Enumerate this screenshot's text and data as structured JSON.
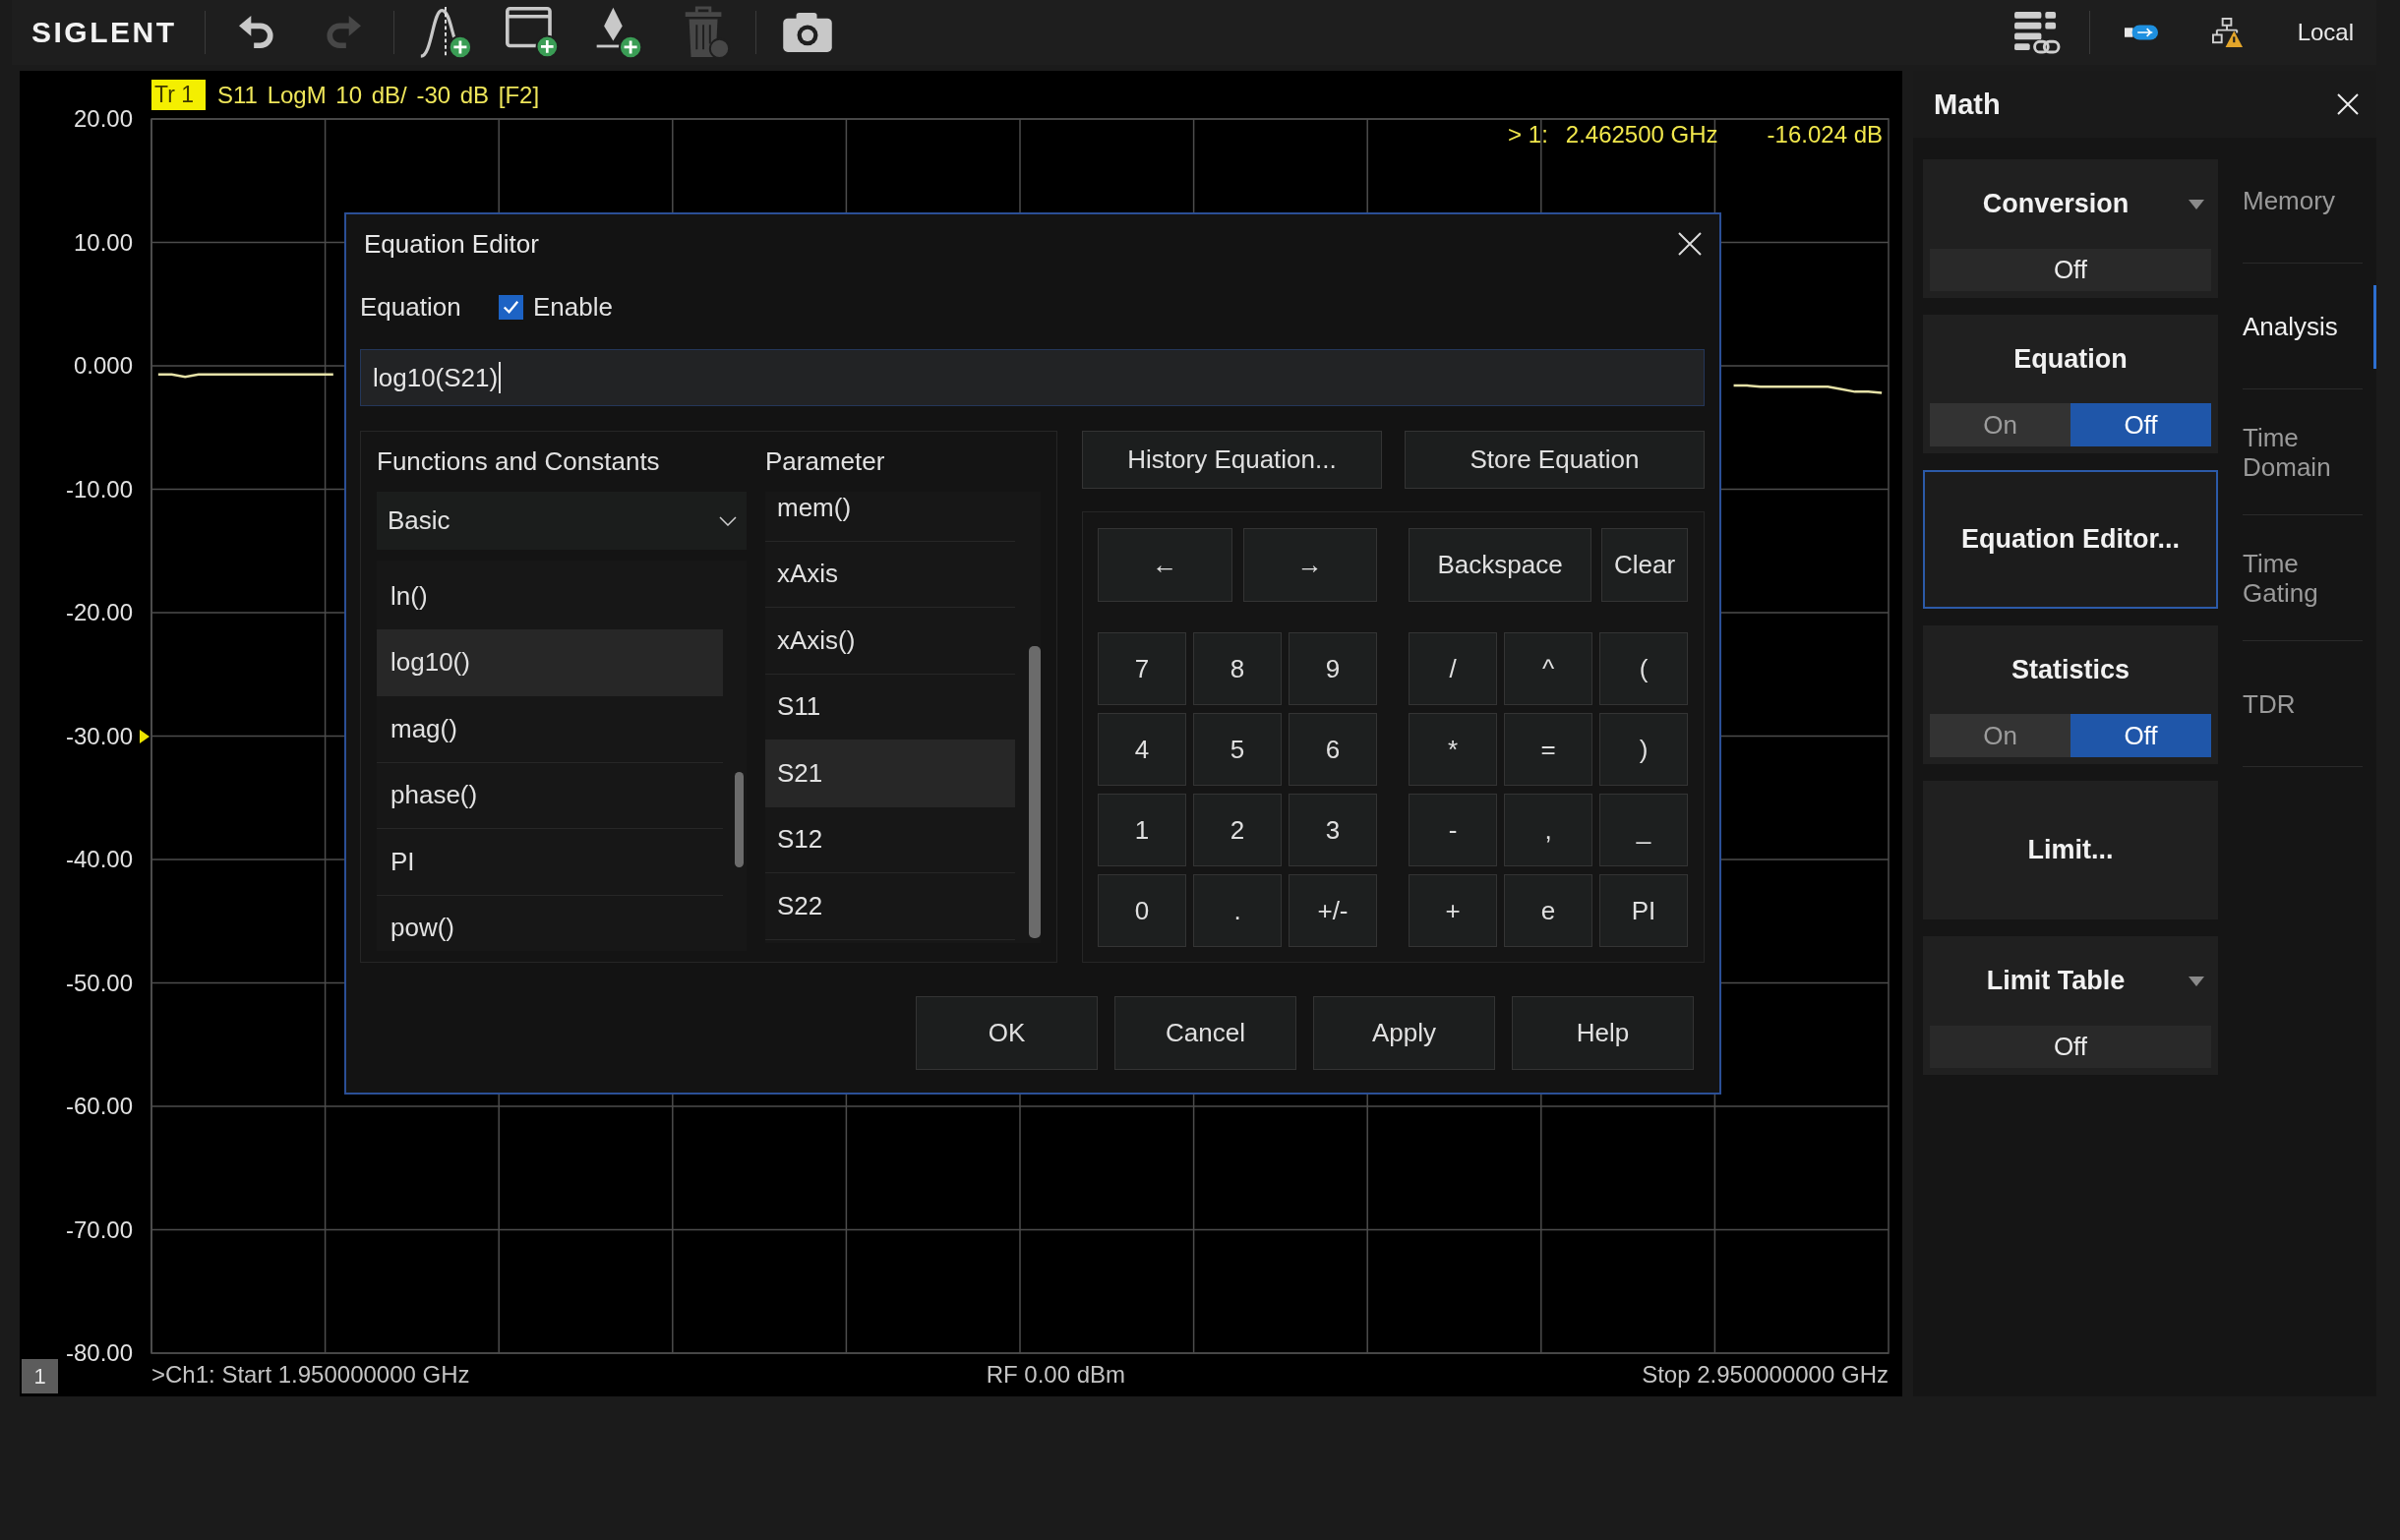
{
  "toolbar": {
    "logo": "SIGLENT",
    "tool_groups": [
      [
        {
          "kind": "undo",
          "disabled": false
        },
        {
          "kind": "redo",
          "disabled": true
        }
      ],
      [
        {
          "kind": "add-trace",
          "disabled": false
        },
        {
          "kind": "add-window",
          "disabled": false
        },
        {
          "kind": "add-marker",
          "disabled": false
        },
        {
          "kind": "delete",
          "disabled": true
        }
      ],
      [
        {
          "kind": "screenshot",
          "disabled": false
        }
      ]
    ],
    "remote_status": "Local"
  },
  "chart": {
    "trace_info": "S11 LogM 10 dB/ -30 dB [F2]",
    "marker": {
      "label": "> 1:",
      "frequency": "2.462500 GHz",
      "value": "-16.024 dB"
    },
    "reference_position": {
      "level": 0.5
    },
    "chart_data": {
      "type": "line",
      "grid": true,
      "categories": [
        null,
        null,
        null,
        null,
        null,
        null,
        null,
        null,
        null,
        null,
        null,
        null,
        null,
        null,
        null,
        null,
        null,
        null,
        null,
        null,
        null,
        null,
        null,
        null,
        null,
        null,
        null,
        null,
        null,
        null,
        null,
        null,
        null,
        null,
        null,
        null,
        null,
        null,
        null,
        null,
        null,
        null,
        null,
        null,
        null,
        null,
        null,
        null,
        null,
        null,
        null,
        null,
        null,
        null,
        null,
        null,
        null,
        null,
        null,
        null,
        null,
        null,
        null,
        null,
        null,
        null,
        null,
        null,
        null,
        null,
        null,
        null,
        null,
        null,
        null,
        null,
        null,
        null,
        null,
        null,
        null,
        null,
        null,
        null,
        null,
        null,
        null,
        null,
        null,
        null,
        null,
        null,
        null,
        null,
        null,
        null,
        null,
        null,
        null,
        null,
        null,
        null,
        null,
        null,
        null,
        null,
        null,
        null,
        null,
        null,
        null,
        null,
        null,
        null,
        null,
        null,
        null,
        null,
        null,
        null,
        null,
        null,
        null,
        null,
        null,
        null,
        null,
        null,
        null
      ],
      "ylim": [
        -80,
        20
      ],
      "yticks": [
        {
          "value": 20,
          "label": "20.00"
        },
        {
          "value": 10,
          "label": "10.00"
        },
        {
          "value": 0,
          "label": "0.000"
        },
        {
          "value": -10,
          "label": "-10.00"
        },
        {
          "value": -20,
          "label": "-20.00"
        },
        {
          "value": -30,
          "label": "-30.00"
        },
        {
          "value": -40,
          "label": "-40.00"
        },
        {
          "value": -50,
          "label": "-50.00"
        },
        {
          "value": -60,
          "label": "-60.00"
        },
        {
          "value": -70,
          "label": "-70.00"
        },
        {
          "value": -80,
          "label": "-80.00"
        }
      ],
      "series": [
        {
          "name": "Tr 1",
          "color": "#e6e2a8",
          "values": [
            -0.7,
            -0.7,
            -0.9,
            -0.7,
            -0.7,
            -0.7,
            -0.7,
            -0.7,
            -0.7,
            -0.7,
            -0.7,
            -0.7,
            -0.7,
            -0.7,
            null,
            null,
            null,
            null,
            null,
            null,
            null,
            null,
            null,
            null,
            null,
            null,
            null,
            null,
            null,
            null,
            null,
            null,
            null,
            null,
            null,
            null,
            null,
            null,
            null,
            null,
            null,
            null,
            null,
            null,
            null,
            null,
            null,
            null,
            null,
            null,
            null,
            null,
            null,
            null,
            null,
            null,
            null,
            null,
            null,
            null,
            null,
            null,
            null,
            null,
            null,
            null,
            null,
            null,
            null,
            null,
            null,
            null,
            null,
            null,
            null,
            null,
            null,
            null,
            null,
            null,
            null,
            null,
            null,
            null,
            null,
            null,
            null,
            null,
            null,
            null,
            null,
            null,
            null,
            null,
            null,
            null,
            null,
            null,
            null,
            null,
            null,
            null,
            null,
            null,
            null,
            null,
            null,
            null,
            null,
            null,
            null,
            null,
            null,
            null,
            null,
            null,
            null,
            -1.6,
            -1.6,
            -1.7,
            -1.7,
            -1.7,
            -1.7,
            -1.7,
            -1.7,
            -1.9,
            -2.1,
            -2.1,
            -2.2
          ]
        }
      ]
    },
    "footer": {
      "channel": "1",
      "start": ">Ch1: Start 1.950000000 GHz",
      "power": "RF 0.00 dBm",
      "stop": "Stop 2.950000000 GHz"
    }
  },
  "dialog": {
    "title": "Equation Editor",
    "equation_label": "Equation",
    "enable": {
      "label": "Enable",
      "checked": true
    },
    "equation": {
      "value": "log10(S21)"
    },
    "functions": {
      "heading": "Functions and Constants",
      "category": "Basic",
      "items": [
        {
          "label": "ln()",
          "selected": false
        },
        {
          "label": "log10()",
          "selected": true
        },
        {
          "label": "mag()",
          "selected": false
        },
        {
          "label": "phase()",
          "selected": false
        },
        {
          "label": "PI",
          "selected": false
        },
        {
          "label": "pow()",
          "selected": false
        }
      ]
    },
    "parameters": {
      "heading": "Parameter",
      "items": [
        {
          "label": "mem()",
          "selected": false
        },
        {
          "label": "xAxis",
          "selected": false
        },
        {
          "label": "xAxis()",
          "selected": false
        },
        {
          "label": "S11",
          "selected": false
        },
        {
          "label": "S21",
          "selected": true
        },
        {
          "label": "S12",
          "selected": false
        },
        {
          "label": "S22",
          "selected": false
        }
      ]
    },
    "history_button": "History Equation...",
    "store_button": "Store Equation",
    "keypad": {
      "nav_keys": [
        "←",
        "→"
      ],
      "edit_keys": [
        "Backspace",
        "Clear"
      ],
      "digit_keys": [
        "7",
        "8",
        "9",
        "4",
        "5",
        "6",
        "1",
        "2",
        "3",
        "0",
        ".",
        "+/-"
      ],
      "operator_keys": [
        "/",
        "^",
        "(",
        "*",
        "=",
        ")",
        "-",
        ",",
        "_",
        "+",
        "e",
        "PI"
      ]
    },
    "buttons": [
      "OK",
      "Cancel",
      "Apply",
      "Help"
    ]
  },
  "math_panel": {
    "title": "Math",
    "cards": [
      {
        "kind": "dropdown",
        "title": "Conversion",
        "value": "Off"
      },
      {
        "kind": "toggle",
        "title": "Equation",
        "options": [
          {
            "label": "On",
            "selected": false
          },
          {
            "label": "Off",
            "selected": true
          }
        ]
      },
      {
        "kind": "action",
        "title": "Equation Editor...",
        "selected": true
      },
      {
        "kind": "toggle",
        "title": "Statistics",
        "options": [
          {
            "label": "On",
            "selected": false
          },
          {
            "label": "Off",
            "selected": true
          }
        ]
      },
      {
        "kind": "action",
        "title": "Limit...",
        "selected": false
      },
      {
        "kind": "dropdown",
        "title": "Limit Table",
        "value": "Off"
      }
    ],
    "tabs": [
      {
        "label": "Memory",
        "selected": false
      },
      {
        "label": "Analysis",
        "selected": true
      },
      {
        "label": "Time Domain",
        "selected": false
      },
      {
        "label": "Time Gating",
        "selected": false
      },
      {
        "label": "TDR",
        "selected": false
      }
    ]
  }
}
